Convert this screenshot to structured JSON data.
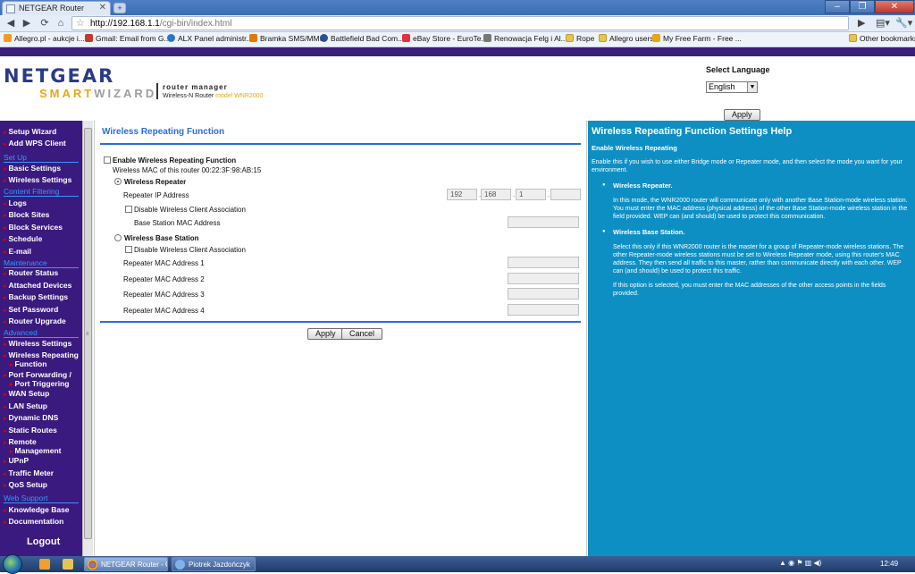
{
  "browser": {
    "tab_title": "NETGEAR Router",
    "new_tab": "+",
    "url_host": "http://192.168.1.1",
    "url_path": "/cgi-bin/index.html",
    "bookmarks": [
      "Allegro.pl - aukcje i...",
      "Gmail: Email from G...",
      "ALX Panel administr...",
      "Bramka SMS/MMS",
      "Battlefield Bad Com...",
      "eBay Store - EuroTe...",
      "Renowacja Felg i Al...",
      "Rope",
      "Allegro users",
      "My Free Farm - Free ...",
      "Other bookmarks"
    ]
  },
  "header": {
    "logo_main": "NETGEAR",
    "logo_smart": "SMART",
    "logo_wizard": "WIZARD",
    "tagline": "router manager",
    "product": "Wireless-N Router",
    "model": "model WNR2000",
    "language_label": "Select Language",
    "language_value": "English",
    "apply": "Apply"
  },
  "sidebar": {
    "top": [
      "Setup Wizard",
      "Add WPS Client"
    ],
    "setup_title": "Set Up",
    "setup": [
      "Basic Settings",
      "Wireless Settings"
    ],
    "content_title": "Content Filtering",
    "content": [
      "Logs",
      "Block Sites",
      "Block Services",
      "Schedule",
      "E-mail"
    ],
    "maint_title": "Maintenance",
    "maint": [
      "Router Status",
      "Attached Devices",
      "Backup Settings",
      "Set Password",
      "Router Upgrade"
    ],
    "adv_title": "Advanced",
    "adv": [
      "Wireless Settings",
      "Wireless Repeating",
      "Function",
      "Port Forwarding /",
      "Port Triggering",
      "WAN Setup",
      "LAN Setup",
      "Dynamic DNS",
      "Static Routes",
      "Remote",
      "Management",
      "UPnP",
      "Traffic Meter",
      "QoS Setup"
    ],
    "web_title": "Web Support",
    "web": [
      "Knowledge Base",
      "Documentation"
    ],
    "logout": "Logout"
  },
  "main": {
    "title": "Wireless Repeating Function",
    "enable_label": "Enable Wireless Repeating Function",
    "mac_line": "Wireless MAC of this router 00:22:3F:98:AB:15",
    "repeater_label": "Wireless Repeater",
    "repeater_ip_label": "Repeater IP Address",
    "ip": [
      "192",
      "168",
      "1",
      ""
    ],
    "disable_assoc": "Disable Wireless Client Association",
    "base_mac_label": "Base Station MAC Address",
    "base_label": "Wireless Base Station",
    "rep_mac": [
      "Repeater MAC Address 1",
      "Repeater MAC Address 2",
      "Repeater MAC Address 3",
      "Repeater MAC Address 4"
    ],
    "apply": "Apply",
    "cancel": "Cancel"
  },
  "help": {
    "title": "Wireless Repeating Function Settings Help",
    "sub": "Enable Wireless Repeating",
    "intro": "Enable this if you wish to use either Bridge mode or Repeater mode, and then select the mode you want for your environment.",
    "b1": "Wireless Repeater.",
    "p1": "In this mode, the WNR2000 router will communicate only with another Base Station-mode wireless station. You must enter the MAC address (physical address) of the other Base Station-mode wireless station in the field provided. WEP can (and should) be used to protect this communication.",
    "b2": "Wireless Base Station.",
    "p2": "Select this only if this WNR2000 router is the master for a group of Repeater-mode wireless stations. The other Repeater-mode wireless stations must be set to Wireless Repeater mode, using this router's MAC address. They then send all traffic to this master, rather than communicate directly with each other. WEP can (and should) be used to protect this traffic.",
    "p3": "If this option is selected, you must enter the MAC addresses of the other access points in the fields provided."
  },
  "taskbar": {
    "task1": "NETGEAR Router - G...",
    "task2": "Piotrek Jazdończyk",
    "clock": "12:49"
  }
}
